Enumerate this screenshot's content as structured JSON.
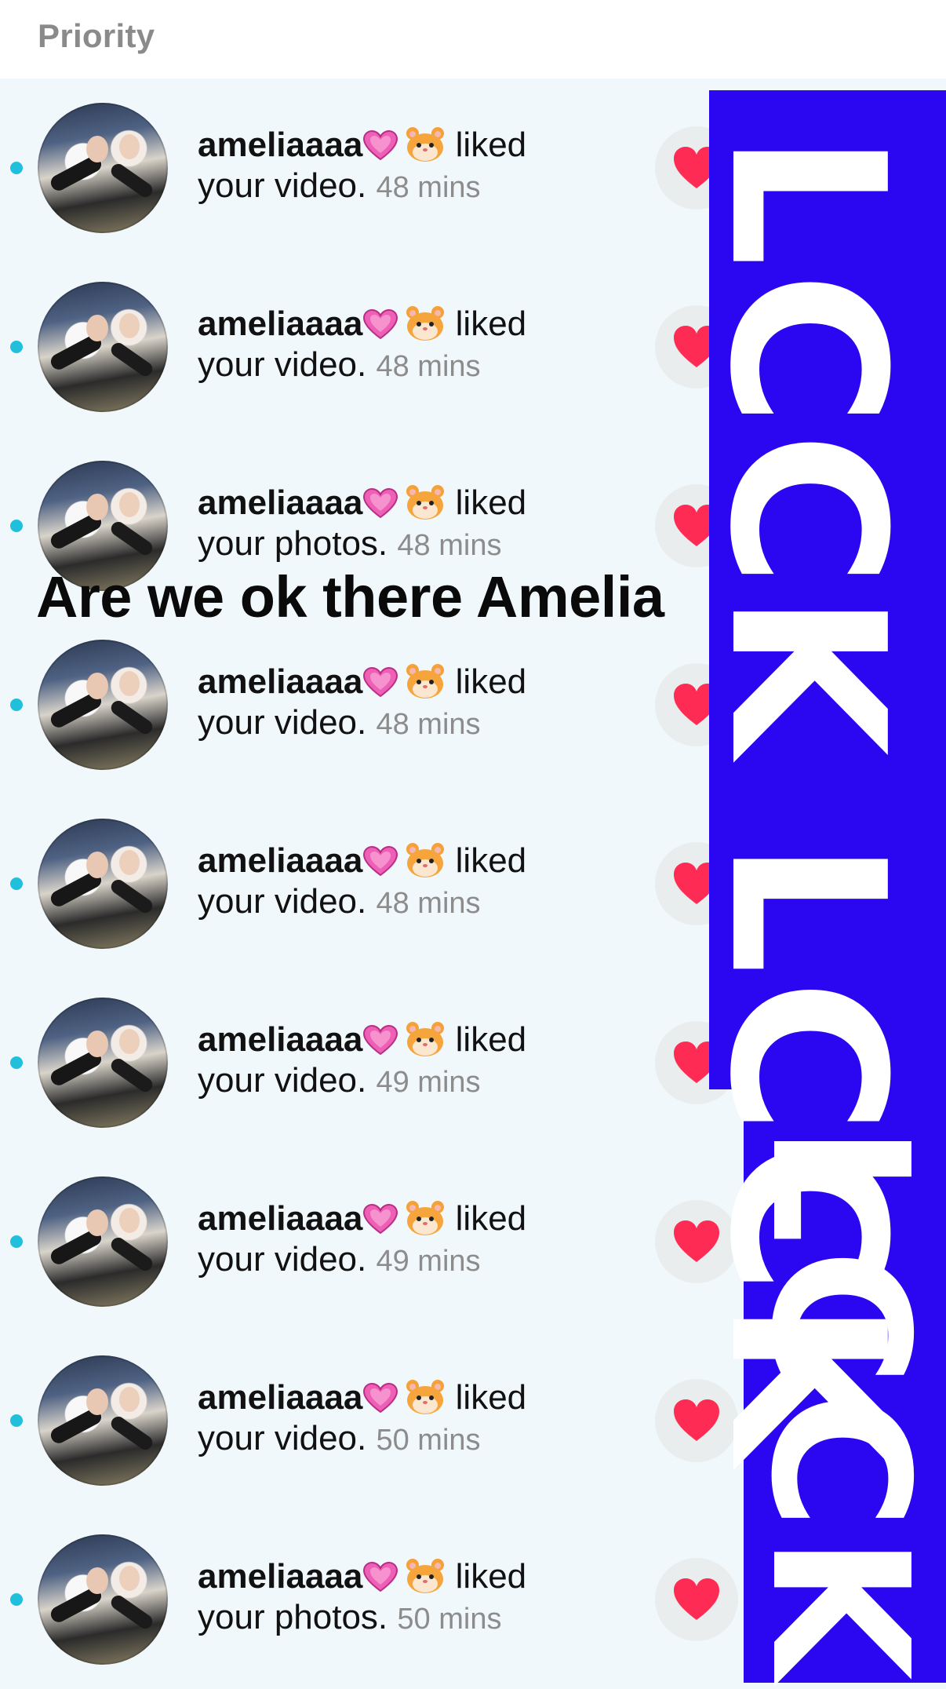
{
  "header": {
    "title": "Priority"
  },
  "notifications": [
    {
      "username": "ameliaaaa",
      "action_line1": "liked",
      "action_line2": "your video.",
      "time": "48 mins"
    },
    {
      "username": "ameliaaaa",
      "action_line1": "liked",
      "action_line2": "your video.",
      "time": "48 mins"
    },
    {
      "username": "ameliaaaa",
      "action_line1": "liked",
      "action_line2": "your photos.",
      "time": "48 mins"
    },
    {
      "username": "ameliaaaa",
      "action_line1": "liked",
      "action_line2": "your video.",
      "time": "48 mins"
    },
    {
      "username": "ameliaaaa",
      "action_line1": "liked",
      "action_line2": "your video.",
      "time": "48 mins"
    },
    {
      "username": "ameliaaaa",
      "action_line1": "liked",
      "action_line2": "your video.",
      "time": "49 mins"
    },
    {
      "username": "ameliaaaa",
      "action_line1": "liked",
      "action_line2": "your video.",
      "time": "49 mins"
    },
    {
      "username": "ameliaaaa",
      "action_line1": "liked",
      "action_line2": "your video.",
      "time": "50 mins"
    },
    {
      "username": "ameliaaaa",
      "action_line1": "liked",
      "action_line2": "your photos.",
      "time": "50 mins"
    }
  ],
  "overlay": {
    "caption": "Are we ok there Amelia",
    "banner_text_1": "LCCK LCCK",
    "banner_text_2": "LCCK"
  },
  "icons": {
    "username_emoji_1": "pink-heart-icon",
    "username_emoji_2": "hamster-icon",
    "action_icon": "red-heart-icon",
    "unread_indicator": "unread-dot-icon"
  },
  "colors": {
    "background": "#f1f8fb",
    "unread_dot": "#20c0dd",
    "like_heart": "#fe2c55",
    "banner": "#2a07f0"
  }
}
